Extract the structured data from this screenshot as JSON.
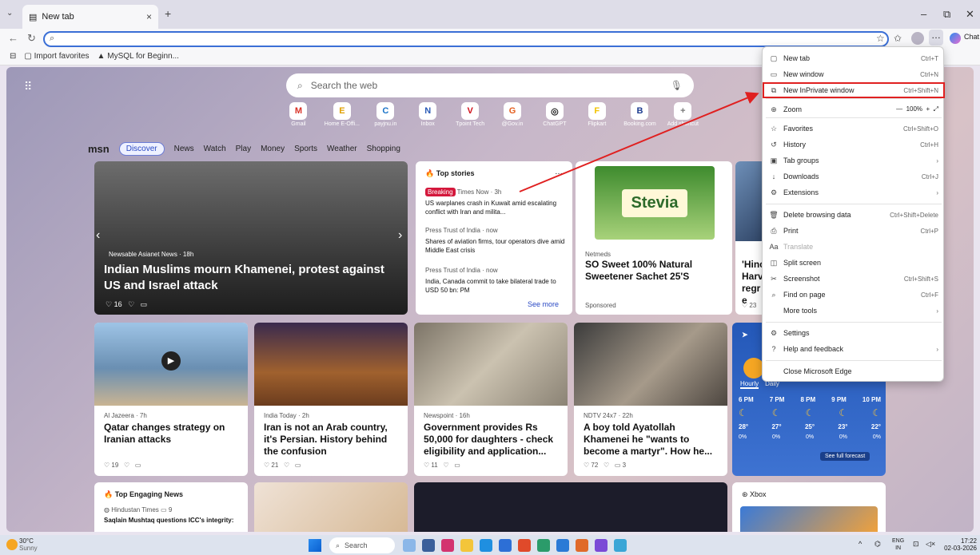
{
  "browser": {
    "tab_title": "New tab",
    "favorites": [
      "Import favorites",
      "MySQL for Beginn..."
    ],
    "toolbar_right": "Chat"
  },
  "newtab": {
    "search_placeholder": "Search the web",
    "quick_links": [
      {
        "label": "Gmail",
        "glyph": "M",
        "color": "#d93025"
      },
      {
        "label": "Home E-Offi...",
        "glyph": "E",
        "color": "#e0a000"
      },
      {
        "label": "payjnu.in",
        "glyph": "C",
        "color": "#1a73c8"
      },
      {
        "label": "Inbox",
        "glyph": "N",
        "color": "#2a5bb7"
      },
      {
        "label": "Tpoint Tech",
        "glyph": "V",
        "color": "#d0101a"
      },
      {
        "label": "@Gov.in",
        "glyph": "G",
        "color": "#e35d1d"
      },
      {
        "label": "ChatGPT",
        "glyph": "◎",
        "color": "#222222"
      },
      {
        "label": "Flipkart",
        "glyph": "F",
        "color": "#f3c300"
      },
      {
        "label": "Booking.com",
        "glyph": "B",
        "color": "#1c3b8f"
      },
      {
        "label": "Add shortcut",
        "glyph": "+",
        "color": "#777777"
      }
    ],
    "feed_tabs": [
      "msn",
      "Discover",
      "News",
      "Watch",
      "Play",
      "Money",
      "Sports",
      "Weather",
      "Shopping"
    ],
    "hero": {
      "source": "Newsable Asianet News · 18h",
      "title": "Indian Muslims mourn Khamenei, protest against US and Israel attack",
      "likes": "16"
    },
    "top_stories": {
      "header": "Top stories",
      "items": [
        {
          "badge": "Breaking",
          "meta": "Times Now · 3h",
          "headline": "US warplanes crash in Kuwait amid escalating conflict with Iran and milita..."
        },
        {
          "meta": "Press Trust of India · now",
          "headline": "Shares of aviation firms, tour operators dive amid Middle East crisis"
        },
        {
          "meta": "Press Trust of India · now",
          "headline": "India, Canada commit to take bilateral trade to USD 50 bn: PM"
        }
      ],
      "see_more": "See more"
    },
    "ad": {
      "source": "Netmeds",
      "title": "SO Sweet 100% Natural Sweetener Sachet 25'S",
      "footer": "Sponsored",
      "brand": "Stevia"
    },
    "partial_card": {
      "title_lines": "'Hinc Harv regre",
      "likes": "23"
    },
    "cards": [
      {
        "meta": "Al Jazeera · 7h",
        "title": "Qatar changes strategy on Iranian attacks",
        "likes": "19"
      },
      {
        "meta": "India Today · 2h",
        "title": "Iran is not an Arab country, it's Persian. History behind the confusion",
        "likes": "21"
      },
      {
        "meta": "Newspoint · 16h",
        "title": "Government provides Rs 50,000 for daughters - check eligibility and application...",
        "likes": "11"
      },
      {
        "meta": "NDTV 24x7 · 22h",
        "title": "A boy told Ayatollah Khamenei he \"wants to become a martyr\". How he...",
        "likes": "72",
        "comments": "3"
      }
    ],
    "weather": {
      "tabs": [
        "Hourly",
        "Daily"
      ],
      "hours": [
        "6 PM",
        "7 PM",
        "8 PM",
        "9 PM",
        "10 PM"
      ],
      "temps": [
        "28°",
        "27°",
        "25°",
        "23°",
        "22°"
      ],
      "precip": [
        "0%",
        "0%",
        "0%",
        "0%",
        "0%"
      ],
      "link": "See full forecast"
    },
    "bottom": {
      "engaging_header": "Top Engaging News",
      "engaging_meta": "Hindustan Times",
      "engaging_count": "9",
      "engaging_headline": "Saqlain Mushtaq questions ICC's integrity:",
      "xbox": "Xbox"
    }
  },
  "menu": {
    "items": [
      {
        "icon": "▢",
        "label": "New tab",
        "shortcut": "Ctrl+T"
      },
      {
        "icon": "▭",
        "label": "New window",
        "shortcut": "Ctrl+N"
      },
      {
        "icon": "⧉",
        "label": "New InPrivate window",
        "shortcut": "Ctrl+Shift+N"
      },
      {
        "icon": "⊕",
        "label": "Zoom",
        "shortcut": ""
      },
      {
        "icon": "☆",
        "label": "Favorites",
        "shortcut": "Ctrl+Shift+O"
      },
      {
        "icon": "↺",
        "label": "History",
        "shortcut": "Ctrl+H"
      },
      {
        "icon": "▣",
        "label": "Tab groups",
        "shortcut": "›"
      },
      {
        "icon": "↓",
        "label": "Downloads",
        "shortcut": "Ctrl+J"
      },
      {
        "icon": "⚙",
        "label": "Extensions",
        "shortcut": "›"
      },
      {
        "icon": "🗑",
        "label": "Delete browsing data",
        "shortcut": "Ctrl+Shift+Delete"
      },
      {
        "icon": "⎙",
        "label": "Print",
        "shortcut": "Ctrl+P"
      },
      {
        "icon": "Aa",
        "label": "Translate",
        "shortcut": ""
      },
      {
        "icon": "◫",
        "label": "Split screen",
        "shortcut": ""
      },
      {
        "icon": "✂",
        "label": "Screenshot",
        "shortcut": "Ctrl+Shift+S"
      },
      {
        "icon": "⌕",
        "label": "Find on page",
        "shortcut": "Ctrl+F"
      },
      {
        "icon": "",
        "label": "More tools",
        "shortcut": "›"
      },
      {
        "icon": "⚙",
        "label": "Settings",
        "shortcut": ""
      },
      {
        "icon": "?",
        "label": "Help and feedback",
        "shortcut": "›"
      },
      {
        "icon": "",
        "label": "Close Microsoft Edge",
        "shortcut": ""
      }
    ],
    "zoom_value": "100%",
    "highlight_color": "#e02020"
  },
  "taskbar": {
    "temp": "30°C",
    "condition": "Sunny",
    "search": "Search",
    "lang": "ENG",
    "region": "IN",
    "time": "17:22",
    "date": "02-03-2026"
  }
}
